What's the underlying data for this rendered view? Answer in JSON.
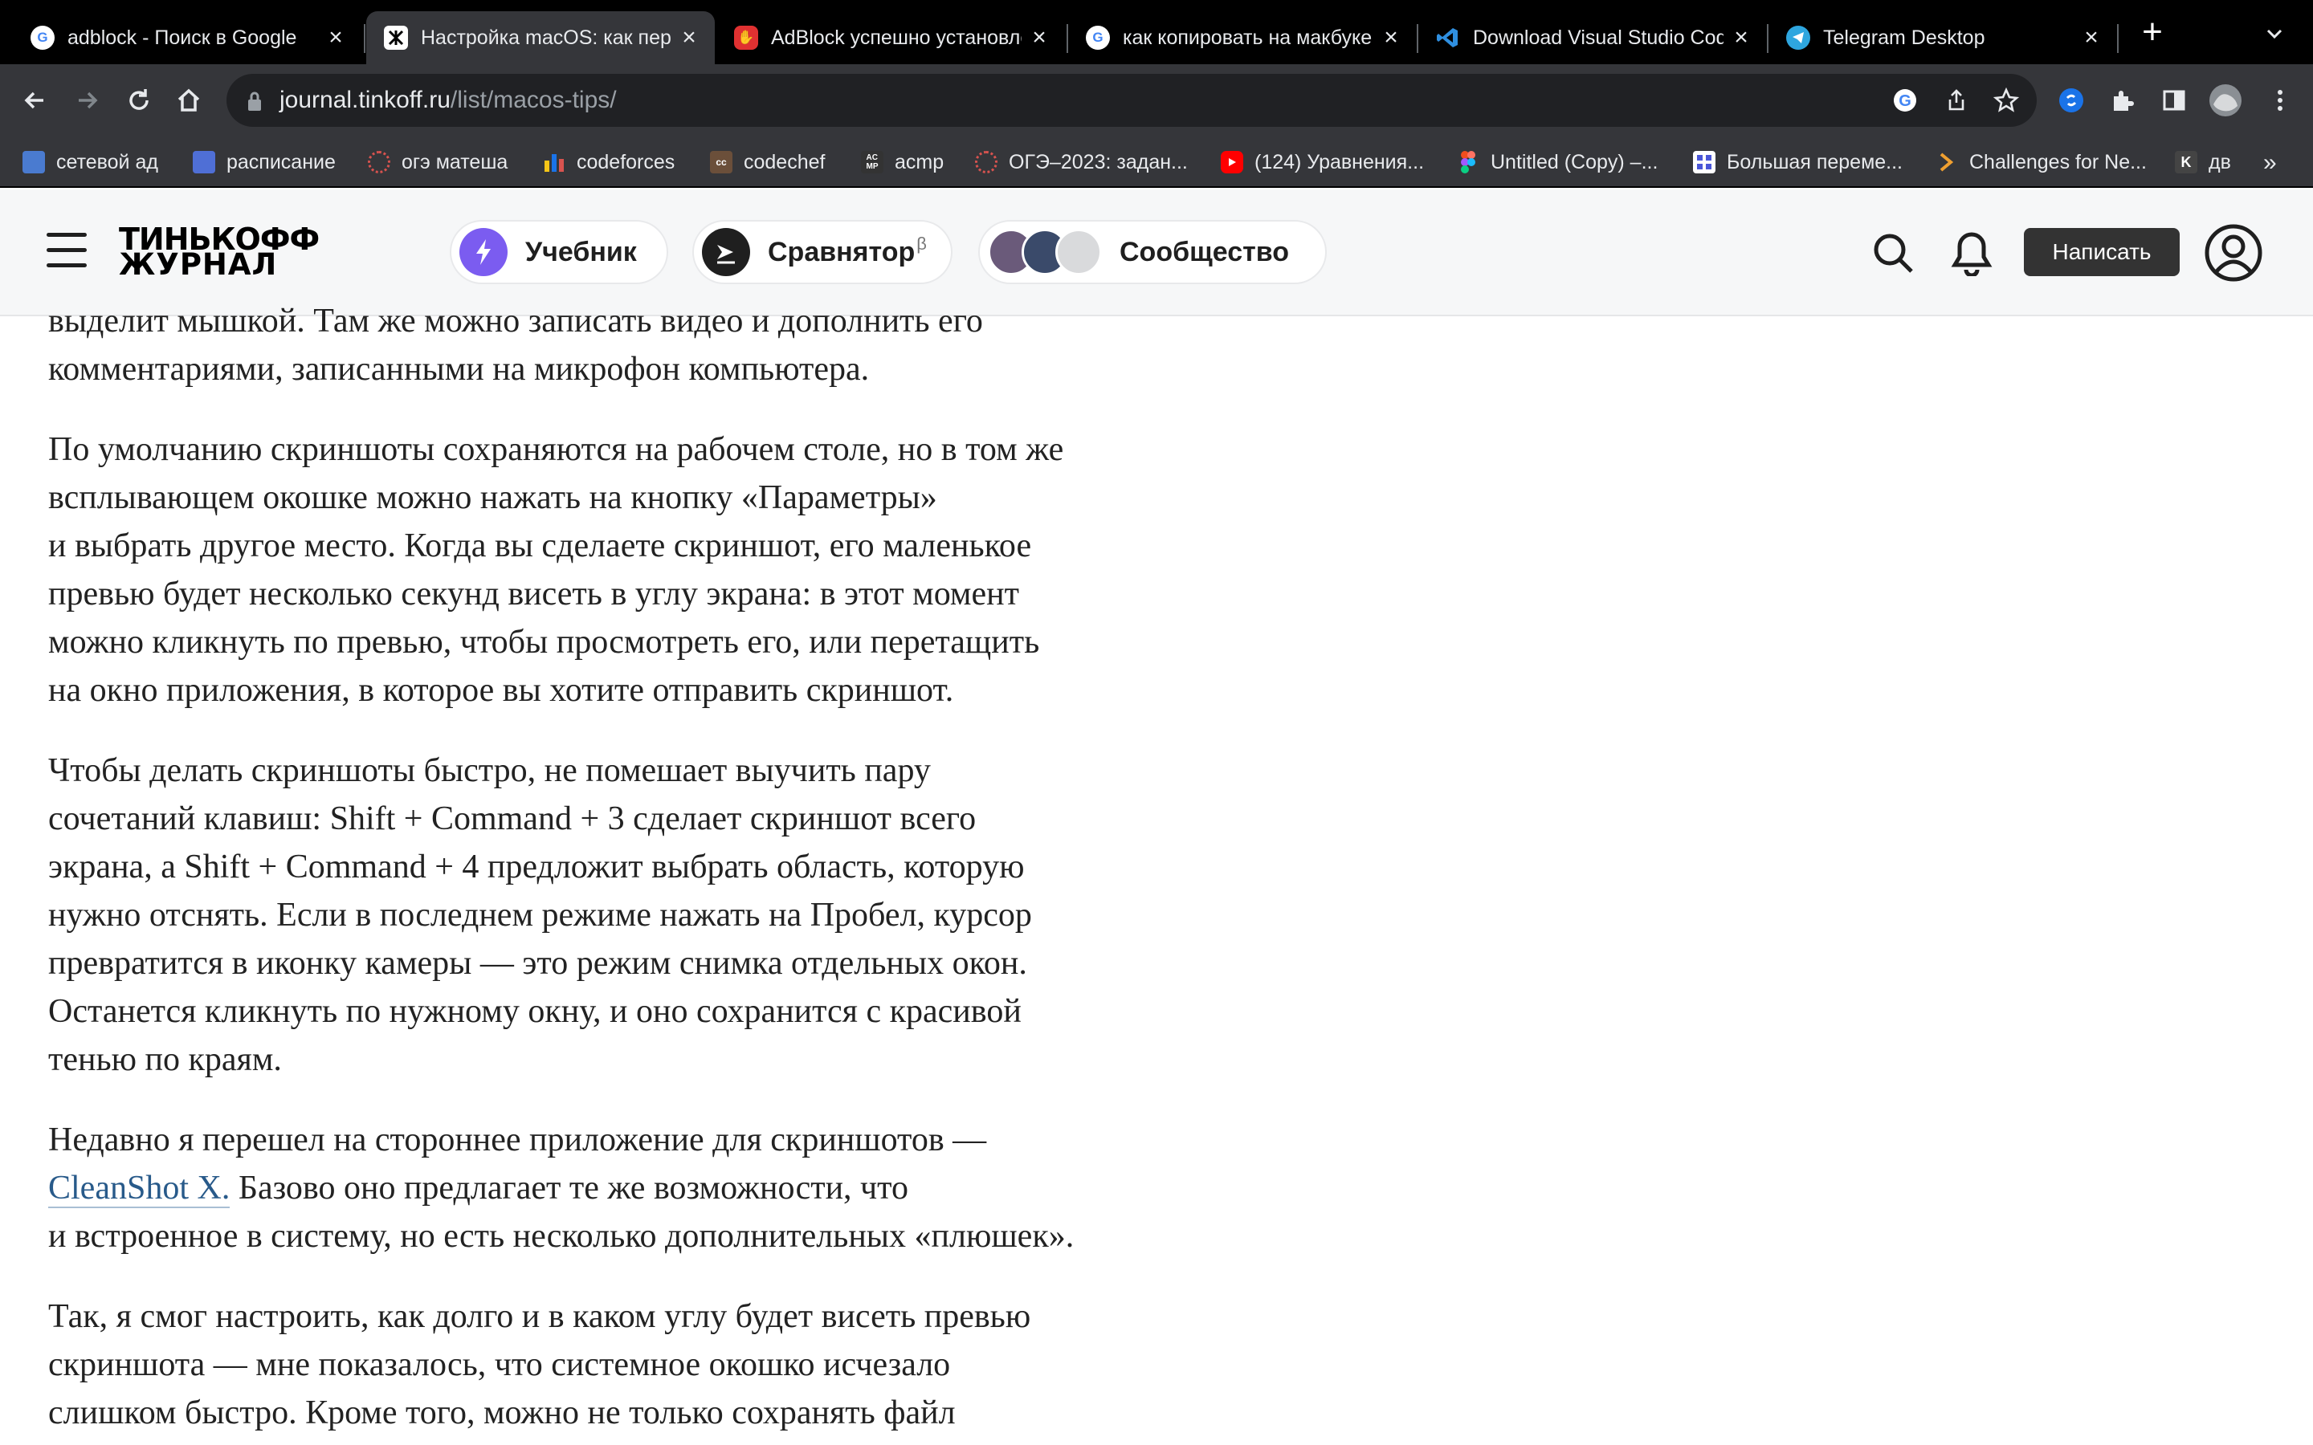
{
  "browser": {
    "tabs": [
      {
        "title": "adblock - Поиск в Google",
        "favicon": "google-icon",
        "active": false
      },
      {
        "title": "Настройка macOS: как переносить",
        "favicon": "tinkoff-journal-icon",
        "active": true
      },
      {
        "title": "AdBlock успешно установлен",
        "favicon": "adblock-icon",
        "active": false
      },
      {
        "title": "как копировать на макбуке",
        "favicon": "google-icon",
        "active": false
      },
      {
        "title": "Download Visual Studio Code",
        "favicon": "vscode-icon",
        "active": false
      },
      {
        "title": "Telegram Desktop",
        "favicon": "telegram-icon",
        "active": false
      }
    ],
    "new_tab_label": "+",
    "address": {
      "domain": "journal.tinkoff.ru",
      "path": "/list/macos-tips/"
    },
    "bookmarks": [
      {
        "label": "сетевой ад",
        "icon": "calendar-icon",
        "color": "#4a7bd0"
      },
      {
        "label": "расписание",
        "icon": "calendar-icon",
        "color": "#4f6fd6"
      },
      {
        "label": "огэ матеша",
        "icon": "dots-circle-icon",
        "color": "#d9534f"
      },
      {
        "label": "codeforces",
        "icon": "bars-icon",
        "color": "#f5c518"
      },
      {
        "label": "codechef",
        "icon": "codechef-icon",
        "color": "#6b4f3a"
      },
      {
        "label": "acmp",
        "icon": "acmp-icon",
        "color": "#333333"
      },
      {
        "label": "ОГЭ–2023: задан...",
        "icon": "dots-circle-icon",
        "color": "#d9534f"
      },
      {
        "label": "(124) Уравнения...",
        "icon": "youtube-icon",
        "color": "#ff0000"
      },
      {
        "label": "Untitled (Copy) –...",
        "icon": "figma-icon",
        "color": "#a259ff"
      },
      {
        "label": "Большая переме...",
        "icon": "grid-icon",
        "color": "#4a56d8"
      },
      {
        "label": "Challenges for Ne...",
        "icon": "challenge-icon",
        "color": "#f0a030"
      },
      {
        "label": "дв",
        "icon": "k-icon",
        "color": "#444444"
      }
    ],
    "bookmarks_more": "»"
  },
  "site": {
    "logo_line1": "ТИНЬКОФФ",
    "logo_line2": "ЖУРНАЛ",
    "nav": [
      {
        "label": "Учебник",
        "icon": "lightning-icon",
        "color": "#7b5cf0"
      },
      {
        "label": "Сравнятор",
        "badge": "β",
        "icon": "arrow-icon",
        "color": "#1f1f1f"
      },
      {
        "label": "Сообщество",
        "icon": "avatars-icon"
      }
    ],
    "write_label": "Написать"
  },
  "article": {
    "p1": "выделит мышкой. Там же можно записать видео и дополнить его\nкомментариями, записанными на микрофон компьютера.",
    "p2": "По умолчанию скриншоты сохраняются на рабочем столе, но в том же\nвсплывающем окошке можно нажать на кнопку «Параметры»\nи выбрать другое место. Когда вы сделаете скриншот, его маленькое\nпревью будет несколько секунд висеть в углу экрана: в этот момент\nможно кликнуть по превью, чтобы просмотреть его, или перетащить\nна окно приложения, в которое вы хотите отправить скриншот.",
    "p3": "Чтобы делать скриншоты быстро, не помешает выучить пару\nсочетаний клавиш: Shift + Command + 3 сделает скриншот всего\nэкрана, а Shift + Command + 4 предложит выбрать область, которую\nнужно отснять. Если в последнем режиме нажать на Пробел, курсор\nпревратится в иконку камеры — это режим снимка отдельных окон.\nОстанется кликнуть по нужному окну, и оно сохранится с красивой\nтенью по краям.",
    "p4_pre": "Недавно я перешел на стороннее приложение для скриншотов —\n",
    "p4_link": "CleanShot X.",
    "p4_post": " Базово оно предлагает те же возможности, что\nи встроенное в систему, но есть несколько дополнительных «плюшек».",
    "p5": "Так, я смог настроить, как долго и в каком углу будет висеть превью\nскриншота — мне показалось, что системное окошко исчезало\nслишком быстро. Кроме того, можно не только сохранять файл"
  }
}
